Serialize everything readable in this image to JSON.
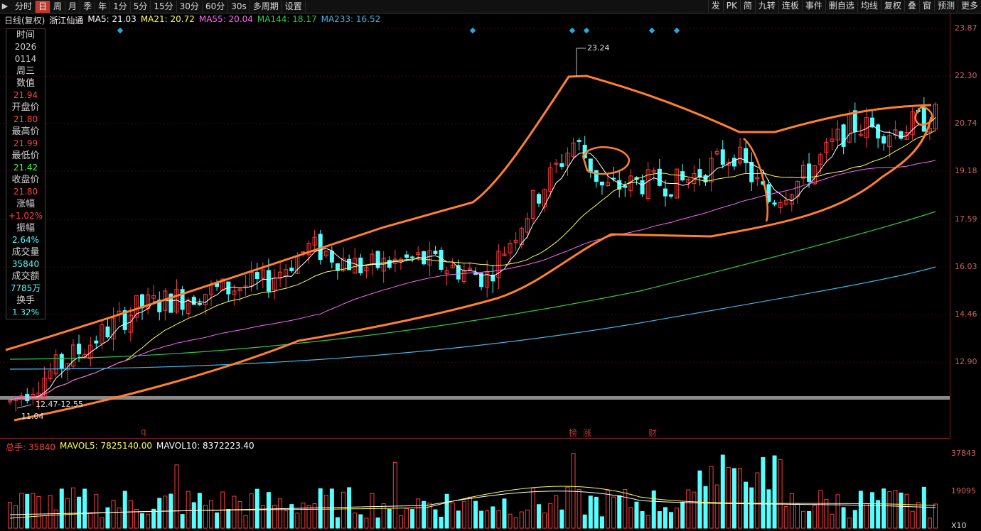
{
  "toolbar": {
    "left_items": [
      "分时",
      "日",
      "周",
      "月",
      "季",
      "年",
      "1分",
      "5分",
      "15分",
      "30分",
      "60分",
      "30s",
      "多周期",
      "设置"
    ],
    "active_item": "日",
    "right_items": [
      "发",
      "PK",
      "简",
      "九转",
      "连板",
      "事件",
      "删自选",
      "均线",
      "复权",
      "叠",
      "窗",
      "预测",
      "更多"
    ]
  },
  "header": {
    "period_label": "日线(复权)",
    "stock_name": "浙江仙通",
    "ma5": "MA5: 21.03",
    "ma21": "MA21: 20.72",
    "ma55": "MA55: 20.04",
    "ma144": "MA144: 18.17",
    "ma233": "MA233: 16.52"
  },
  "info_panel": [
    {
      "label": "时间",
      "value": "2026"
    },
    {
      "label": "",
      "value": "0114"
    },
    {
      "label": "周三",
      "value": ""
    },
    {
      "label": "数值",
      "value": "21.94"
    },
    {
      "label": "开盘价",
      "value": "21.80"
    },
    {
      "label": "最高价",
      "value": "21.99"
    },
    {
      "label": "最低价",
      "value": "21.42"
    },
    {
      "label": "收盘价",
      "value": "21.80"
    },
    {
      "label": "涨幅",
      "value": "+1.02%"
    },
    {
      "label": "振幅",
      "value": "2.64%"
    },
    {
      "label": "成交量",
      "value": "35840"
    },
    {
      "label": "成交额",
      "value": "7785万"
    },
    {
      "label": "换手",
      "value": "1.32%"
    }
  ],
  "price_axis": [
    "23.87",
    "22.30",
    "20.74",
    "19.18",
    "17.59",
    "16.03",
    "14.46",
    "12.90"
  ],
  "annotations": {
    "high_label": "23.24",
    "range_label": "12.47-12.55",
    "low_label": "11.04",
    "q_marker": "q"
  },
  "event_tags": [
    "榜",
    "涨",
    "财"
  ],
  "volume_header": {
    "total": "总手: 35840",
    "mavol5": "MAVOL5: 7825140.00",
    "mavol10": "MAVOL10: 8372223.40"
  },
  "volume_axis": [
    "37843",
    "19095",
    "X10"
  ],
  "colors": {
    "up": "#ff3b3b",
    "down": "#54ffff",
    "ma5": "#ffffff",
    "ma21": "#ffff4f",
    "ma55": "#ff66ff",
    "ma144": "#2ecc40",
    "ma233": "#3fb8e8",
    "annotation": "#ff8030"
  },
  "chart_data": {
    "type": "candlestick",
    "title": "浙江仙通 日线(复权)",
    "ylim": [
      11.04,
      23.87
    ],
    "y_ticks": [
      12.9,
      14.46,
      16.03,
      17.59,
      19.18,
      20.74,
      22.3,
      23.87
    ],
    "series": [
      {
        "name": "MA5",
        "last": 21.03
      },
      {
        "name": "MA21",
        "last": 20.72
      },
      {
        "name": "MA55",
        "last": 20.04
      },
      {
        "name": "MA144",
        "last": 18.17
      },
      {
        "name": "MA233",
        "last": 16.52
      }
    ],
    "last_bar": {
      "open": 21.8,
      "high": 21.99,
      "low": 21.42,
      "close": 21.8,
      "volume": 35840
    },
    "period_high": 23.24,
    "period_low": 11.04
  }
}
